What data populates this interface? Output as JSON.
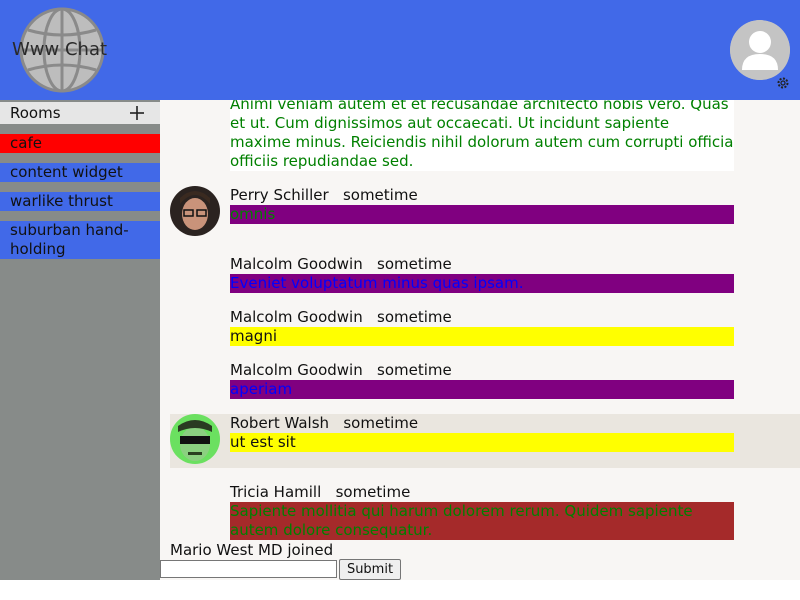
{
  "header": {
    "title": "Www Chat",
    "logo_icon": "globe-icon",
    "user_avatar_icon": "user-avatar-icon",
    "settings_icon": "gear-icon",
    "bg_color": "#4169e8"
  },
  "sidebar": {
    "rooms_label": "Rooms",
    "add_icon": "plus-icon",
    "rooms": [
      {
        "label": "cafe",
        "active": true
      },
      {
        "label": "content widget",
        "active": false
      },
      {
        "label": "warlike thrust",
        "active": false
      },
      {
        "label": "suburban hand-holding",
        "active": false
      }
    ]
  },
  "messages": [
    {
      "text": "Animi veniam autem et et recusandae architecto nobis vero. Quas et ut. Cum dignissimos aut occaecati. Ut incidunt sapiente maxime minus. Reiciendis nihil dolorum autem cum corrupti officia officiis repudiandae sed.",
      "bg": "#ffffff",
      "color": "#008000"
    },
    {
      "author": "Perry Schiller",
      "time": "sometime",
      "text": "omnis",
      "bg": "#800080",
      "color": "#008000"
    },
    {
      "author": "Malcolm Goodwin",
      "time": "sometime",
      "text": "Eveniet voluptatum minus quas ipsam.",
      "bg": "#800080",
      "color": "#0000ff"
    },
    {
      "author": "Malcolm Goodwin",
      "time": "sometime",
      "text": "magni",
      "bg": "#ffff00",
      "color": "#111111"
    },
    {
      "author": "Malcolm Goodwin",
      "time": "sometime",
      "text": "aperiam",
      "bg": "#800080",
      "color": "#0000ff"
    },
    {
      "author": "Robert Walsh",
      "time": "sometime",
      "text": "ut est sit",
      "bg": "#ffff00",
      "color": "#111111"
    },
    {
      "author": "Tricia Hamill",
      "time": "sometime",
      "text": "Sapiente mollitia qui harum dolorem rerum. Quidem sapiente autem dolore consequatur.",
      "bg": "#a52a2a",
      "color": "#008000"
    }
  ],
  "joined_notice": "Mario West MD joined",
  "composer": {
    "placeholder": "",
    "submit_label": "Submit"
  }
}
